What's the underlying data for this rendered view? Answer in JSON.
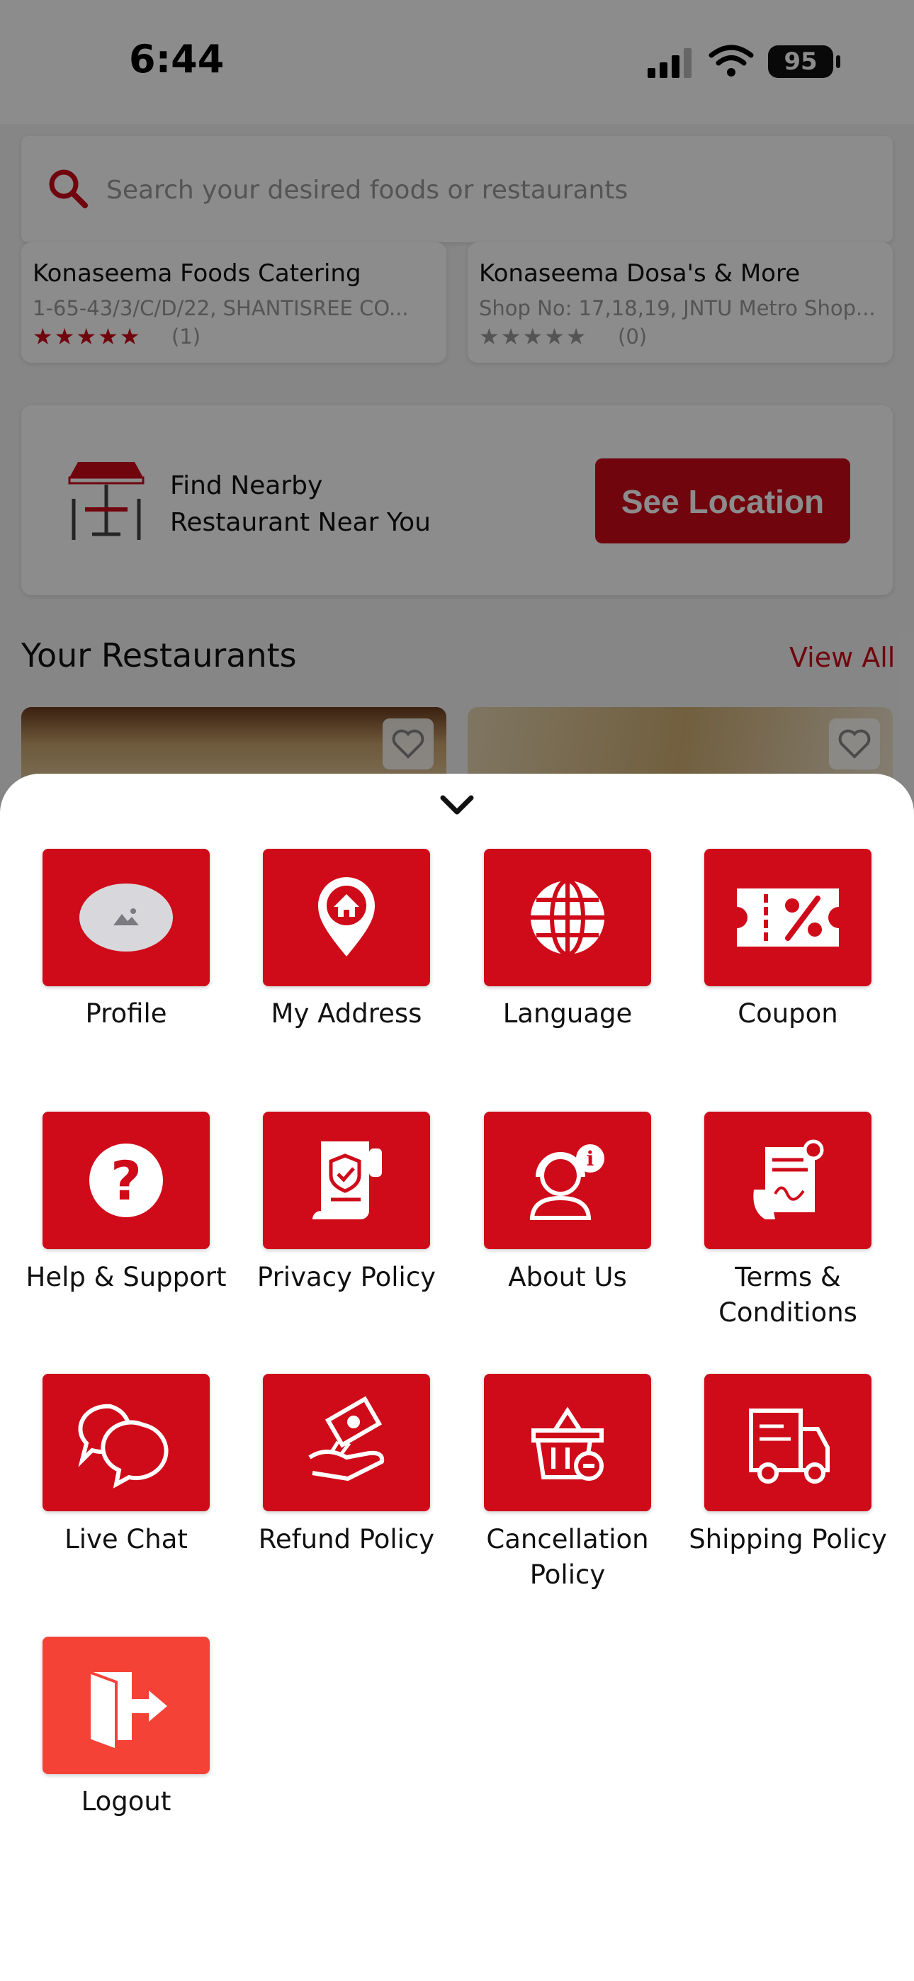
{
  "status_bar": {
    "time": "6:44",
    "battery": "95"
  },
  "search": {
    "placeholder": "Search your desired foods or restaurants"
  },
  "featured": [
    {
      "name": "Konaseema Foods Catering",
      "address": "1-65-43/3/C/D/22, SHANTISREE CO...",
      "rating_count": "(1)",
      "rating": 5
    },
    {
      "name": "Konaseema Dosa's & More",
      "address": "Shop No: 17,18,19, JNTU Metro Shop...",
      "rating_count": "(0)",
      "rating": 0
    }
  ],
  "promo": {
    "line1": "Find Nearby",
    "line2": "Restaurant Near You",
    "button": "See Location"
  },
  "restaurants_section": {
    "title": "Your Restaurants",
    "view_all": "View All"
  },
  "menu": {
    "items": [
      {
        "label": "Profile",
        "icon": "profile-avatar-icon"
      },
      {
        "label": "My Address",
        "icon": "location-home-icon"
      },
      {
        "label": "Language",
        "icon": "globe-icon"
      },
      {
        "label": "Coupon",
        "icon": "coupon-icon"
      },
      {
        "label": "Help & Support",
        "icon": "question-icon"
      },
      {
        "label": "Privacy Policy",
        "icon": "privacy-scroll-icon"
      },
      {
        "label": "About Us",
        "icon": "support-agent-icon"
      },
      {
        "label": "Terms &",
        "label2": "Conditions",
        "icon": "contract-icon"
      },
      {
        "label": "Live Chat",
        "icon": "chat-bubbles-icon"
      },
      {
        "label": "Refund Policy",
        "icon": "refund-hand-icon"
      },
      {
        "label": "Cancellation",
        "label2": "Policy",
        "icon": "basket-cancel-icon"
      },
      {
        "label": "Shipping Policy",
        "icon": "truck-icon"
      },
      {
        "label": "Logout",
        "icon": "logout-door-icon"
      }
    ]
  },
  "colors": {
    "brand_red": "#cf0b19",
    "logout_red": "#f44336"
  }
}
